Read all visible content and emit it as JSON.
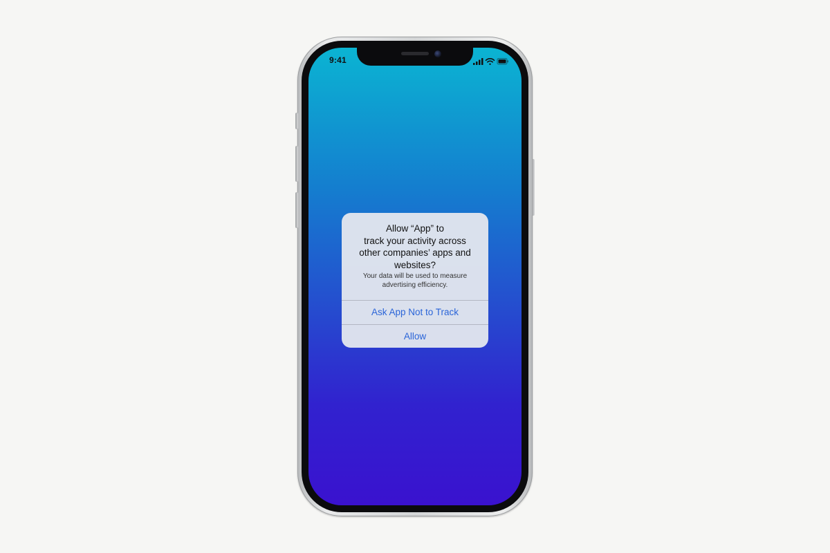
{
  "status_bar": {
    "time": "9:41",
    "icons": [
      "cellular-signal-icon",
      "wifi-icon",
      "battery-icon"
    ]
  },
  "screen": {
    "gradient_top": "#0bb4d2",
    "gradient_bottom": "#3a12cf"
  },
  "dialog": {
    "title": "Allow “App” to\ntrack your activity across\nother companies’ apps and\nwebsites?",
    "message": "Your data will be used to measure\nadvertising efficiency.",
    "buttons": [
      {
        "label": "Ask App Not to Track"
      },
      {
        "label": "Allow"
      }
    ],
    "button_color": "#2a64d8"
  }
}
